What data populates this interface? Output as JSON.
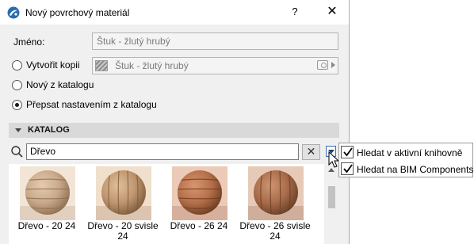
{
  "window": {
    "title": "Nový povrchový materiál",
    "help_label": "?",
    "close_label": "✕"
  },
  "name_row": {
    "label": "Jméno:",
    "value": "Štuk - žlutý hrubý"
  },
  "options": [
    {
      "label": "Vytvořit kopii",
      "checked": false
    },
    {
      "label": "Nový z katalogu",
      "checked": false
    },
    {
      "label": "Přepsat nastavením z katalogu",
      "checked": true
    }
  ],
  "copy_source": {
    "value": "Štuk - žlutý hrubý"
  },
  "catalog": {
    "header": "KATALOG",
    "search_value": "Dřevo",
    "clear_label": "✕"
  },
  "materials": [
    {
      "name": "Dřevo - 20 24",
      "base": "#c9a98a",
      "dark": "#8f6f52",
      "light": "#e6ccb0"
    },
    {
      "name": "Dřevo - 20 svisle 24",
      "base": "#c09670",
      "dark": "#7f5c3c",
      "light": "#e0bf98"
    },
    {
      "name": "Dřevo - 26 24",
      "base": "#b5704a",
      "dark": "#6e3c22",
      "light": "#d89670"
    },
    {
      "name": "Dřevo - 26 svisle 24",
      "base": "#a86c4a",
      "dark": "#6a3f26",
      "light": "#cf9470"
    }
  ],
  "filter_menu": [
    {
      "label": "Hledat v aktivní knihovně",
      "checked": true
    },
    {
      "label": "Hledat na BIM Components",
      "checked": true
    }
  ],
  "icons": {
    "app": "archicad-logo-icon",
    "search": "search-icon",
    "filter": "filter-dropdown-icon",
    "cursor": "mouse-cursor-icon"
  },
  "colors": {
    "dialog_bg": "#f0f0f0",
    "section_bg": "#d9d9d9",
    "accent": "#3b6fb6"
  }
}
